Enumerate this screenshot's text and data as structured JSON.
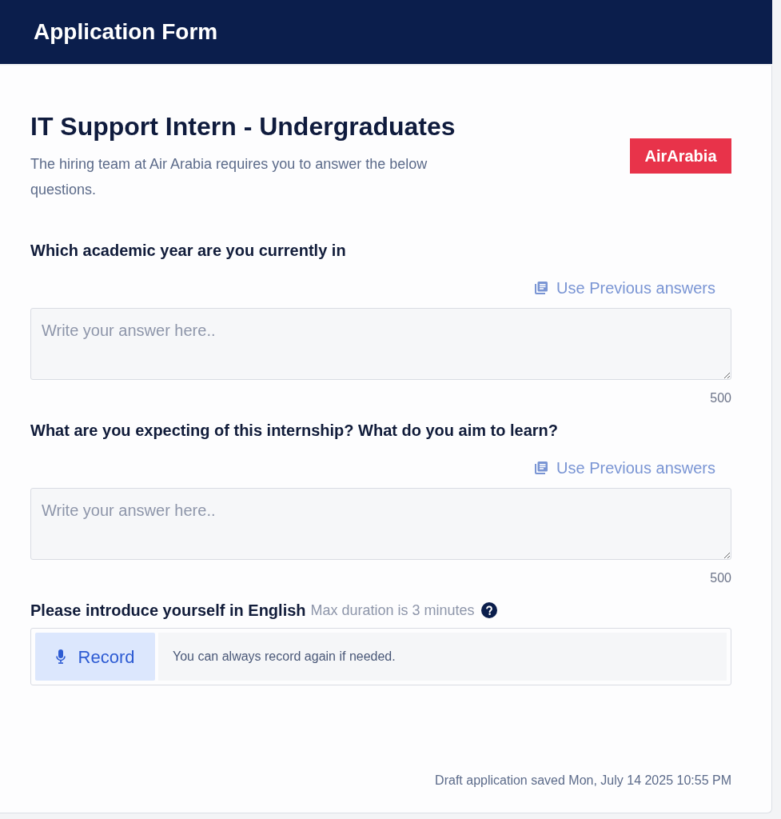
{
  "header": {
    "title": "Application Form"
  },
  "job": {
    "title": "IT Support Intern - Undergraduates",
    "subtitle": "The hiring team at Air Arabia requires you to answer the below questions.",
    "logo": "AirArabia"
  },
  "questions": [
    {
      "kind": "text",
      "label": "Which academic year are you currently in",
      "use_previous": {
        "label": "Use Previous answers",
        "disabled": true
      },
      "placeholder": "Write your answer here..",
      "counter": "500"
    },
    {
      "kind": "text",
      "label": "What are you expecting of this internship? What do you aim to learn?",
      "use_previous": {
        "label": "Use Previous answers",
        "disabled": true
      },
      "placeholder": "Write your answer here..",
      "counter": "500"
    },
    {
      "kind": "recording",
      "label": "Please introduce yourself in English",
      "hint": "Max duration is 3 minutes",
      "record_button": "Record",
      "message": "You can always record again if needed."
    }
  ],
  "footer": {
    "saved": "Draft application saved Mon, July 14 2025 10:55 PM"
  }
}
